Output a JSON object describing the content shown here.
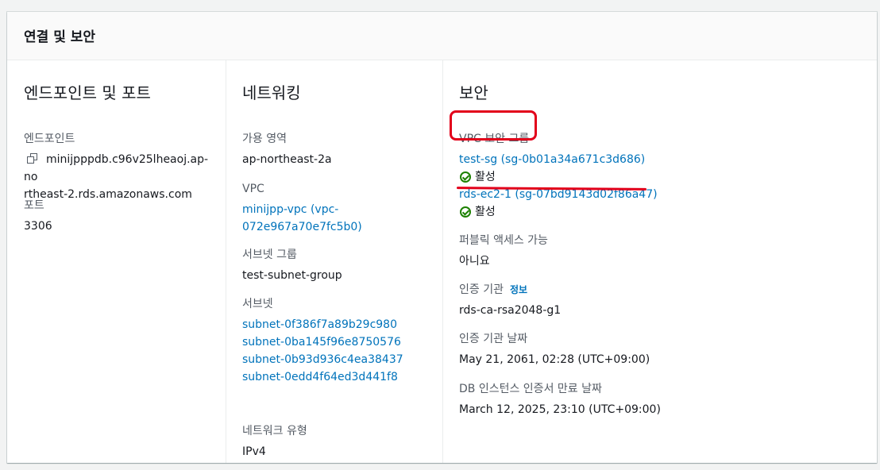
{
  "card": {
    "title": "연결 및 보안"
  },
  "endpoint_section": {
    "title": "엔드포인트 및 포트",
    "endpoint_label": "엔드포인트",
    "endpoint_line1": "minijpppdb.c96v25lheaoj.ap-no",
    "endpoint_line2": "rtheast-2.rds.amazonaws.com",
    "port_label": "포트",
    "port_value": "3306"
  },
  "network_section": {
    "title": "네트워킹",
    "az_label": "가용 영역",
    "az_value": "ap-northeast-2a",
    "vpc_label": "VPC",
    "vpc_line1": "minijpp-vpc (vpc-",
    "vpc_line2": "072e967a70e7fc5b0)",
    "subnet_group_label": "서브넷 그룹",
    "subnet_group_value": "test-subnet-group",
    "subnets_label": "서브넷",
    "subnets": [
      "subnet-0f386f7a89b29c980",
      "subnet-0ba145f96e8750576",
      "subnet-0b93d936c4ea38437",
      "subnet-0edd4f64ed3d441f8"
    ],
    "network_type_label": "네트워크 유형",
    "network_type_value": "IPv4"
  },
  "security_section": {
    "title": "보안",
    "sg_label": "VPC 보안 그룹",
    "security_groups": [
      {
        "name": "test-sg (sg-0b01a34a671c3d686)",
        "status": "활성"
      },
      {
        "name": "rds-ec2-1 (sg-07bd9143d02f86a47)",
        "status": "활성"
      }
    ],
    "public_access_label": "퍼블릭 액세스 가능",
    "public_access_value": "아니요",
    "ca_label": "인증 기관",
    "ca_info": "정보",
    "ca_value": "rds-ca-rsa2048-g1",
    "ca_date_label": "인증 기관 날짜",
    "ca_date_value": "May 21, 2061, 02:28 (UTC+09:00)",
    "cert_expiry_label": "DB 인스턴스 인증서 만료 날짜",
    "cert_expiry_value": "March 12, 2025, 23:10 (UTC+09:00)"
  },
  "colors": {
    "link": "#0073bb",
    "success": "#1d8102",
    "annotation": "#e2001a"
  }
}
